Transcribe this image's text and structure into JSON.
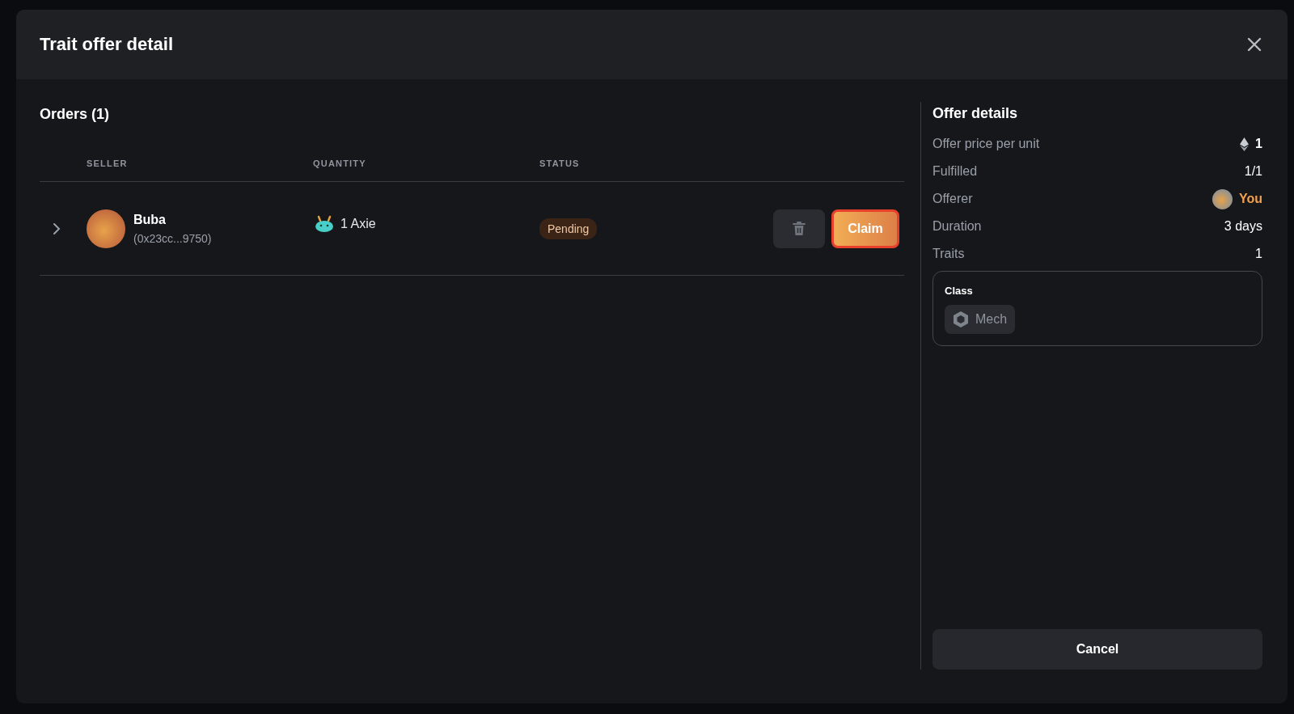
{
  "dialog": {
    "title": "Trait offer detail"
  },
  "orders": {
    "title": "Orders (1)",
    "columns": [
      "SELLER",
      "QUANTITY",
      "STATUS"
    ],
    "rows": [
      {
        "expanded": false,
        "seller_name": "Buba",
        "seller_address": "(0x23cc...9750)",
        "quantity": "1 Axie",
        "status": "Pending",
        "claim_label": "Claim"
      }
    ]
  },
  "offer_details": {
    "title": "Offer details",
    "rows": [
      {
        "kind": "price",
        "label": "Offer price per unit",
        "value": "1"
      },
      {
        "kind": "plain",
        "label": "Fulfilled",
        "value": "1/1"
      },
      {
        "kind": "user",
        "label": "Offerer",
        "value": "You"
      },
      {
        "kind": "plain",
        "label": "Duration",
        "value": "3 days"
      },
      {
        "kind": "plain",
        "label": "Traits",
        "value": "1"
      }
    ],
    "traits": [
      {
        "name": "Class",
        "values": [
          "Mech"
        ]
      }
    ]
  },
  "buttons": [
    "Cancel"
  ]
}
